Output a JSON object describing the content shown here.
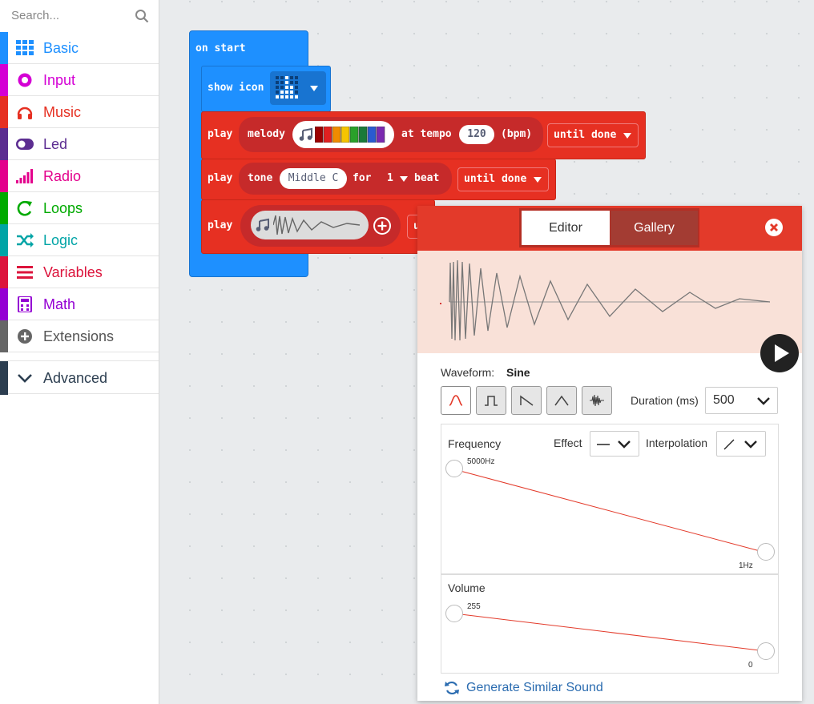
{
  "toolbox": {
    "search_placeholder": "Search...",
    "categories": [
      {
        "label": "Basic",
        "color": "#1e90ff",
        "icon": "grid-icon"
      },
      {
        "label": "Input",
        "color": "#d400d4",
        "icon": "target-icon"
      },
      {
        "label": "Music",
        "color": "#e63022",
        "icon": "headphones-icon"
      },
      {
        "label": "Led",
        "color": "#5c2d91",
        "icon": "toggle-icon"
      },
      {
        "label": "Radio",
        "color": "#e3008c",
        "icon": "signal-bars-icon"
      },
      {
        "label": "Loops",
        "color": "#00aa00",
        "icon": "refresh-icon"
      },
      {
        "label": "Logic",
        "color": "#00a4a6",
        "icon": "shuffle-icon"
      },
      {
        "label": "Variables",
        "color": "#dc143c",
        "icon": "list-icon"
      },
      {
        "label": "Math",
        "color": "#9400d3",
        "icon": "calculator-icon"
      },
      {
        "label": "Extensions",
        "color": "#666666",
        "icon": "plus-circle-icon"
      }
    ],
    "advanced": "Advanced"
  },
  "blocks": {
    "on_start": "on start",
    "show_icon": "show icon",
    "play": "play",
    "melody": "melody",
    "at_tempo": "at tempo",
    "tempo_value": "120",
    "bpm": "(bpm)",
    "until_done": "until done",
    "tone": "tone",
    "tone_note": "Middle C",
    "for": "for",
    "beat_value": "1",
    "beat": "beat",
    "hidden_fragment": "u"
  },
  "editor": {
    "tab_editor": "Editor",
    "tab_gallery": "Gallery",
    "waveform_label": "Waveform:",
    "waveform_value": "Sine",
    "duration_label": "Duration (ms)",
    "duration_value": "500",
    "frequency_label": "Frequency",
    "effect_label": "Effect",
    "interpolation_label": "Interpolation",
    "freq_start": "5000Hz",
    "freq_end": "1Hz",
    "volume_label": "Volume",
    "vol_start": "255",
    "vol_end": "0",
    "generate_label": "Generate Similar Sound"
  },
  "colors": {
    "music_red": "#e63022",
    "basic_blue": "#1e90ff",
    "accent_link": "#2b6cb0"
  }
}
